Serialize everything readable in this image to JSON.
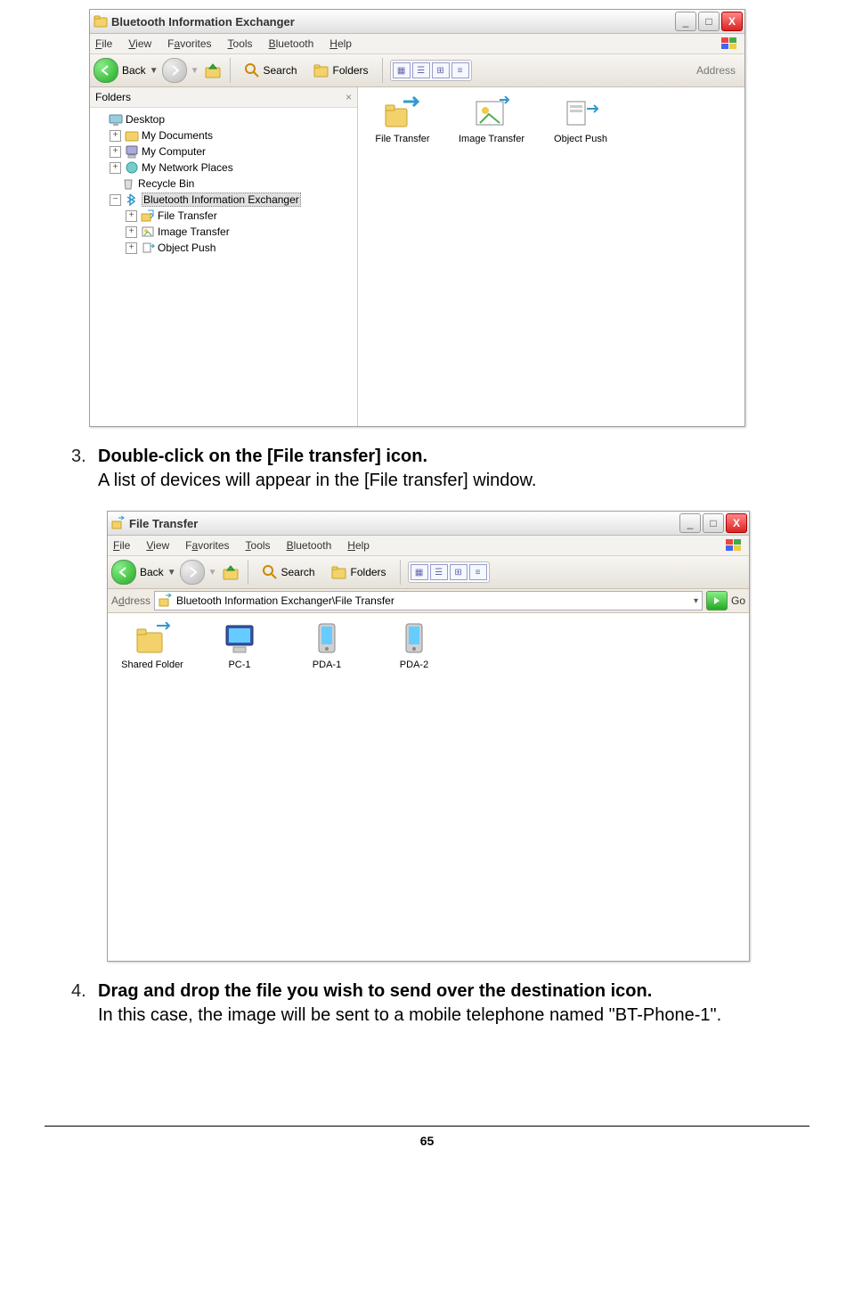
{
  "page_number": "65",
  "step3": {
    "num": "3.",
    "bold": "Double-click on the [File transfer] icon.",
    "text": "A list of devices will appear in the [File transfer] window."
  },
  "step4": {
    "num": "4.",
    "bold": "Drag and drop the file you wish to send over the destination icon.",
    "text": "In this case, the image will be sent to a mobile telephone named \"BT-Phone-1\"."
  },
  "win1": {
    "title": "Bluetooth Information Exchanger",
    "menu": [
      "File",
      "View",
      "Favorites",
      "Tools",
      "Bluetooth",
      "Help"
    ],
    "toolbar": {
      "back": "Back",
      "search": "Search",
      "folders": "Folders",
      "address": "Address"
    },
    "folders_header": "Folders",
    "tree": {
      "desktop": "Desktop",
      "mydocs": "My Documents",
      "mycomp": "My Computer",
      "mynet": "My Network Places",
      "recycle": "Recycle Bin",
      "btie": "Bluetooth Information Exchanger",
      "ft": "File Transfer",
      "it": "Image Transfer",
      "op": "Object Push"
    },
    "content": {
      "file_transfer": "File Transfer",
      "image_transfer": "Image Transfer",
      "object_push": "Object Push"
    }
  },
  "win2": {
    "title": "File Transfer",
    "menu": [
      "File",
      "View",
      "Favorites",
      "Tools",
      "Bluetooth",
      "Help"
    ],
    "toolbar": {
      "back": "Back",
      "search": "Search",
      "folders": "Folders"
    },
    "address_label": "Address",
    "address_value": "Bluetooth Information Exchanger\\File Transfer",
    "go": "Go",
    "content": {
      "shared": "Shared Folder",
      "pc1": "PC-1",
      "pda1": "PDA-1",
      "pda2": "PDA-2"
    }
  }
}
